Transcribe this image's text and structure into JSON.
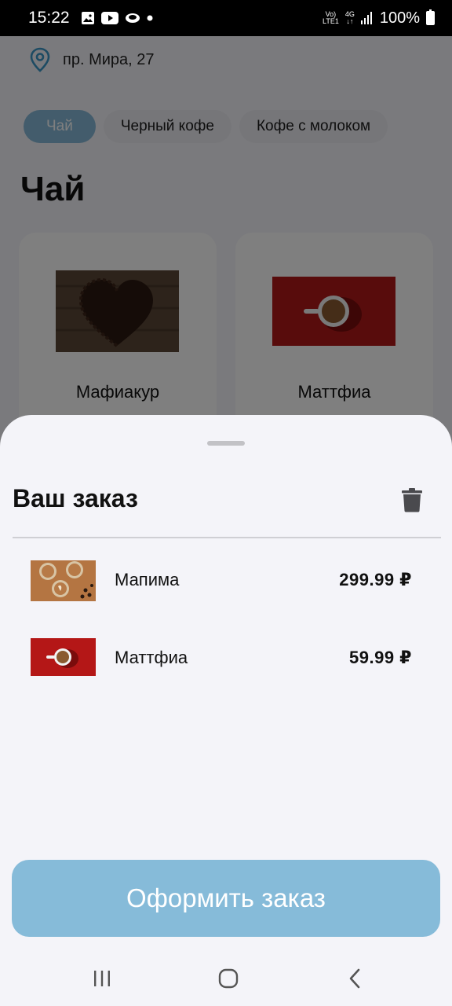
{
  "status_bar": {
    "time": "15:22",
    "network_line1": "Vo)",
    "network_line2": "LTE1",
    "network_type": "4G",
    "battery": "100%"
  },
  "background": {
    "address": "пр. Мира, 27",
    "chips": [
      "Чай",
      "Черный кофе",
      "Кофе с молоком"
    ],
    "section_title": "Чай",
    "cards": [
      {
        "title": "Мафиакур",
        "image": "coffee-beans-heart-image"
      },
      {
        "title": "Маттфиа",
        "image": "coffee-cup-red-image"
      }
    ]
  },
  "sheet": {
    "title": "Ваш заказ",
    "items": [
      {
        "name": "Мапима",
        "price": "299.99 ₽",
        "image": "latte-art-cups-image"
      },
      {
        "name": "Маттфиа",
        "price": "59.99 ₽",
        "image": "coffee-cup-red-image"
      }
    ],
    "checkout_label": "Оформить заказ"
  },
  "colors": {
    "accent": "#86bbd9",
    "overlay": "rgba(0,0,0,0.5)"
  }
}
